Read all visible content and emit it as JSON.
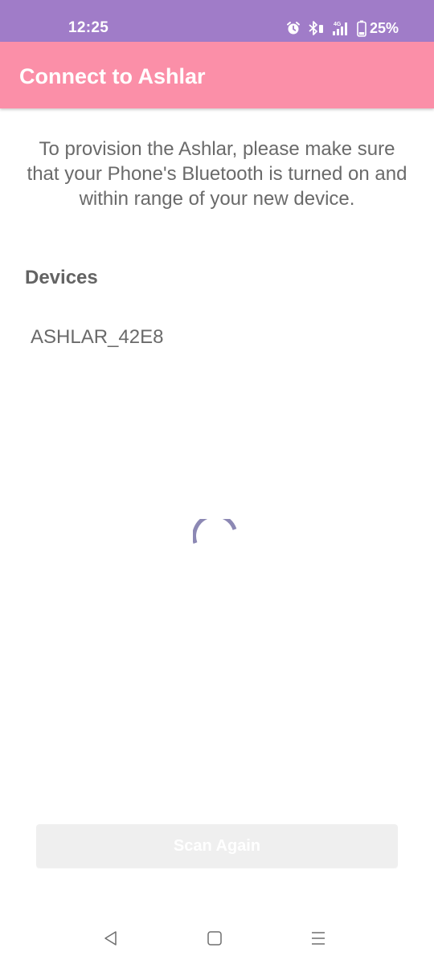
{
  "status_bar": {
    "time": "12:25",
    "battery": "25%",
    "icons": [
      "alarm-icon",
      "bluetooth-icon",
      "signal-4g-icon",
      "battery-icon"
    ]
  },
  "app_bar": {
    "title": "Connect to Ashlar"
  },
  "main": {
    "instructions": "To provision the Ashlar, please make sure that your Phone's Bluetooth is turned on and within range of your new device.",
    "devices_heading": "Devices",
    "devices": [
      {
        "name": "ASHLAR_42E8"
      }
    ],
    "scan_button_label": "Scan Again"
  },
  "navigation_bar": {
    "icons": [
      "back-icon",
      "home-icon",
      "recents-icon"
    ]
  },
  "colors": {
    "status_bar": "#a07cc8",
    "app_bar": "#fb8fa8",
    "spinner": "#8c88b4",
    "button_disabled": "#efefef"
  }
}
